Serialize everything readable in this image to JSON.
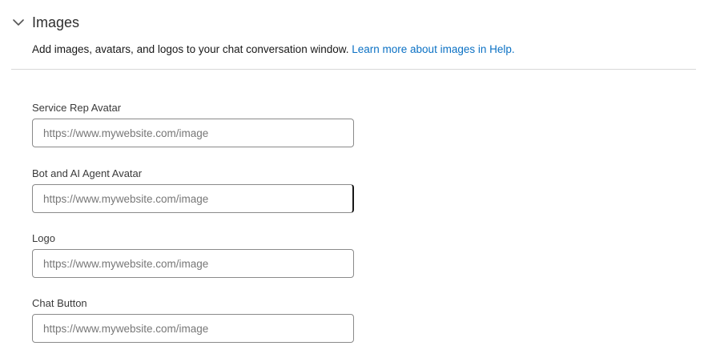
{
  "section": {
    "title": "Images",
    "description": "Add images, avatars, and logos to your chat conversation window.",
    "help_link": "Learn more about images in Help."
  },
  "fields": [
    {
      "label": "Service Rep Avatar",
      "placeholder": "https://www.mywebsite.com/image",
      "value": ""
    },
    {
      "label": "Bot and AI Agent Avatar",
      "placeholder": "https://www.mywebsite.com/image",
      "value": ""
    },
    {
      "label": "Logo",
      "placeholder": "https://www.mywebsite.com/image",
      "value": ""
    },
    {
      "label": "Chat Button",
      "placeholder": "https://www.mywebsite.com/image",
      "value": ""
    }
  ],
  "icons": {
    "section_toggle": "chevron-down-icon"
  },
  "colors": {
    "link": "#0b71c4",
    "input_border": "#8a8a8a",
    "divider": "#d8d8d8"
  }
}
